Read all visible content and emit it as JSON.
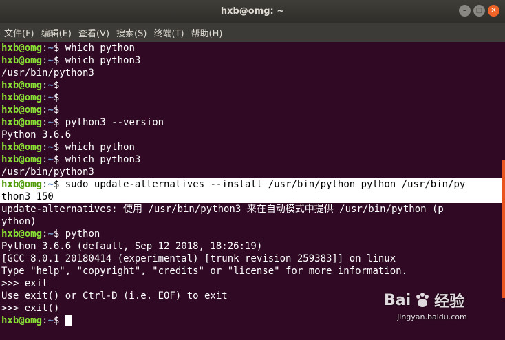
{
  "window": {
    "title": "hxb@omg: ~"
  },
  "menu": [
    "文件(F)",
    "编辑(E)",
    "查看(V)",
    "搜索(S)",
    "终端(T)",
    "帮助(H)"
  ],
  "prompt": {
    "user": "hxb@omg",
    "path": "~",
    "symbol": "$"
  },
  "lines": [
    {
      "type": "prompt",
      "cmd": " which python"
    },
    {
      "type": "prompt",
      "cmd": " which python3"
    },
    {
      "type": "output",
      "text": "/usr/bin/python3"
    },
    {
      "type": "prompt",
      "cmd": ""
    },
    {
      "type": "prompt",
      "cmd": ""
    },
    {
      "type": "prompt",
      "cmd": ""
    },
    {
      "type": "prompt",
      "cmd": " python3 --version"
    },
    {
      "type": "output",
      "text": "Python 3.6.6"
    },
    {
      "type": "prompt",
      "cmd": " which python"
    },
    {
      "type": "prompt",
      "cmd": " which python3"
    },
    {
      "type": "output",
      "text": "/usr/bin/python3"
    },
    {
      "type": "prompt",
      "cmd": " sudo update-alternatives --install /usr/bin/python python /usr/bin/py",
      "highlight": true
    },
    {
      "type": "output",
      "text": "thon3 150",
      "highlight": true
    },
    {
      "type": "output",
      "text": "update-alternatives: 使用 /usr/bin/python3 来在自动模式中提供 /usr/bin/python (p"
    },
    {
      "type": "output",
      "text": "ython)"
    },
    {
      "type": "prompt",
      "cmd": " python"
    },
    {
      "type": "output",
      "text": "Python 3.6.6 (default, Sep 12 2018, 18:26:19)"
    },
    {
      "type": "output",
      "text": "[GCC 8.0.1 20180414 (experimental) [trunk revision 259383]] on linux"
    },
    {
      "type": "output",
      "text": "Type \"help\", \"copyright\", \"credits\" or \"license\" for more information."
    },
    {
      "type": "output",
      "text": ">>> exit"
    },
    {
      "type": "output",
      "text": "Use exit() or Ctrl-D (i.e. EOF) to exit"
    },
    {
      "type": "output",
      "text": ">>> exit()"
    },
    {
      "type": "prompt",
      "cmd": " ",
      "cursor": true
    }
  ],
  "watermark": {
    "logo_a": "Bai",
    "logo_b": "经验",
    "url": "jingyan.baidu.com"
  },
  "colors": {
    "terminal_bg": "#300a24",
    "user": "#8ae234",
    "path": "#729fcf",
    "accent": "#e95420"
  }
}
